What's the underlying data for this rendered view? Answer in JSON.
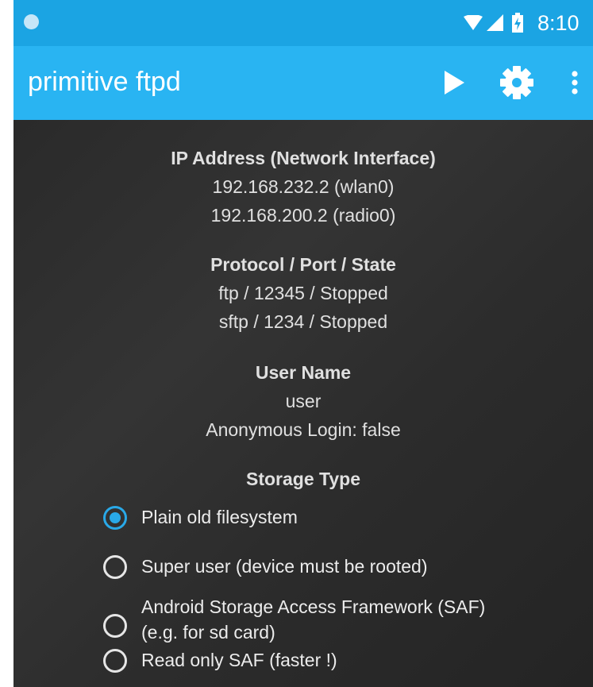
{
  "status_bar": {
    "time": "8:10",
    "icons": [
      "notification-dot-icon",
      "wifi-icon",
      "signal-icon",
      "battery-icon"
    ]
  },
  "app_bar": {
    "title": "primitive ftpd",
    "actions": [
      "play-icon",
      "gear-icon",
      "overflow-menu-icon"
    ]
  },
  "info": {
    "ip": {
      "heading": "IP Address (Network Interface)",
      "lines": [
        "192.168.232.2 (wlan0)",
        "192.168.200.2 (radio0)"
      ]
    },
    "protocol": {
      "heading": "Protocol / Port / State",
      "lines": [
        "ftp / 12345 / Stopped",
        "sftp / 1234 / Stopped"
      ]
    },
    "user": {
      "heading": "User Name",
      "lines": [
        "user",
        "Anonymous Login: false"
      ]
    }
  },
  "storage": {
    "heading": "Storage Type",
    "options": [
      {
        "label": "Plain old filesystem",
        "checked": true
      },
      {
        "label": "Super user (device must be rooted)",
        "checked": false
      },
      {
        "label_line1": "Android Storage Access Framework (SAF)",
        "label_line2": "(e.g. for sd card)",
        "checked": false
      },
      {
        "label": "Read only SAF (faster !)",
        "checked": false
      }
    ]
  },
  "colors": {
    "status_bar": "#1ba4e3",
    "app_bar": "#29b4f2",
    "content_bg": "#2c2c2c",
    "accent": "#29a9e8"
  }
}
